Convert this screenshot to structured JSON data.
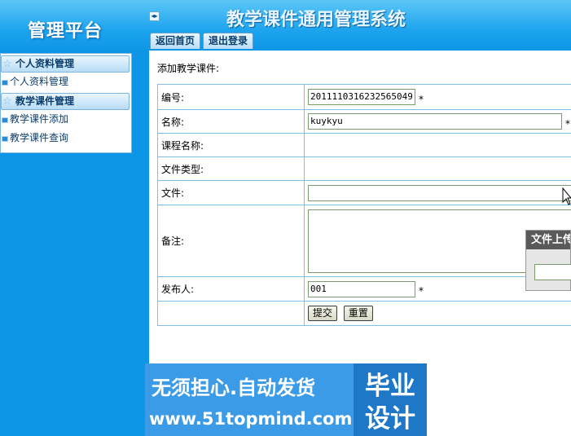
{
  "header": {
    "logo_text": "管理平台",
    "collapse_glyph": "◂▸",
    "system_title": "教学课件通用管理系统",
    "tabs": [
      {
        "label": "返回首页"
      },
      {
        "label": "退出登录"
      }
    ]
  },
  "sidebar": {
    "groups": [
      {
        "label": "个人资料管理",
        "items": [
          {
            "label": "个人资料管理"
          }
        ]
      },
      {
        "label": "教学课件管理",
        "items": [
          {
            "label": "教学课件添加"
          },
          {
            "label": "教学课件查询"
          }
        ]
      }
    ]
  },
  "form": {
    "section_title": "添加教学课件:",
    "fields": {
      "id": {
        "label": "编号:",
        "value": "20111103162325650​49",
        "required_mark": "*"
      },
      "name": {
        "label": "名称:",
        "value": "kuykyu",
        "required_mark": "*"
      },
      "course": {
        "label": "课程名称:"
      },
      "filetype": {
        "label": "文件类型:"
      },
      "file": {
        "label": "文件:",
        "value": ""
      },
      "remark": {
        "label": "备注:",
        "value": ""
      },
      "publisher": {
        "label": "发布人:",
        "value": "001",
        "required_mark": "*"
      }
    },
    "buttons": {
      "submit": "提交",
      "reset": "重置"
    }
  },
  "upload_panel": {
    "title": "文件上传"
  },
  "banner": {
    "slogan": "无须担心.自动发货",
    "url": "www.51topmind.com",
    "badge_line1": "毕业",
    "badge_line2": "设计"
  },
  "colors": {
    "background": "#0e96e6",
    "table_border": "#7ec0e8",
    "banner": "#2f8fe0"
  }
}
